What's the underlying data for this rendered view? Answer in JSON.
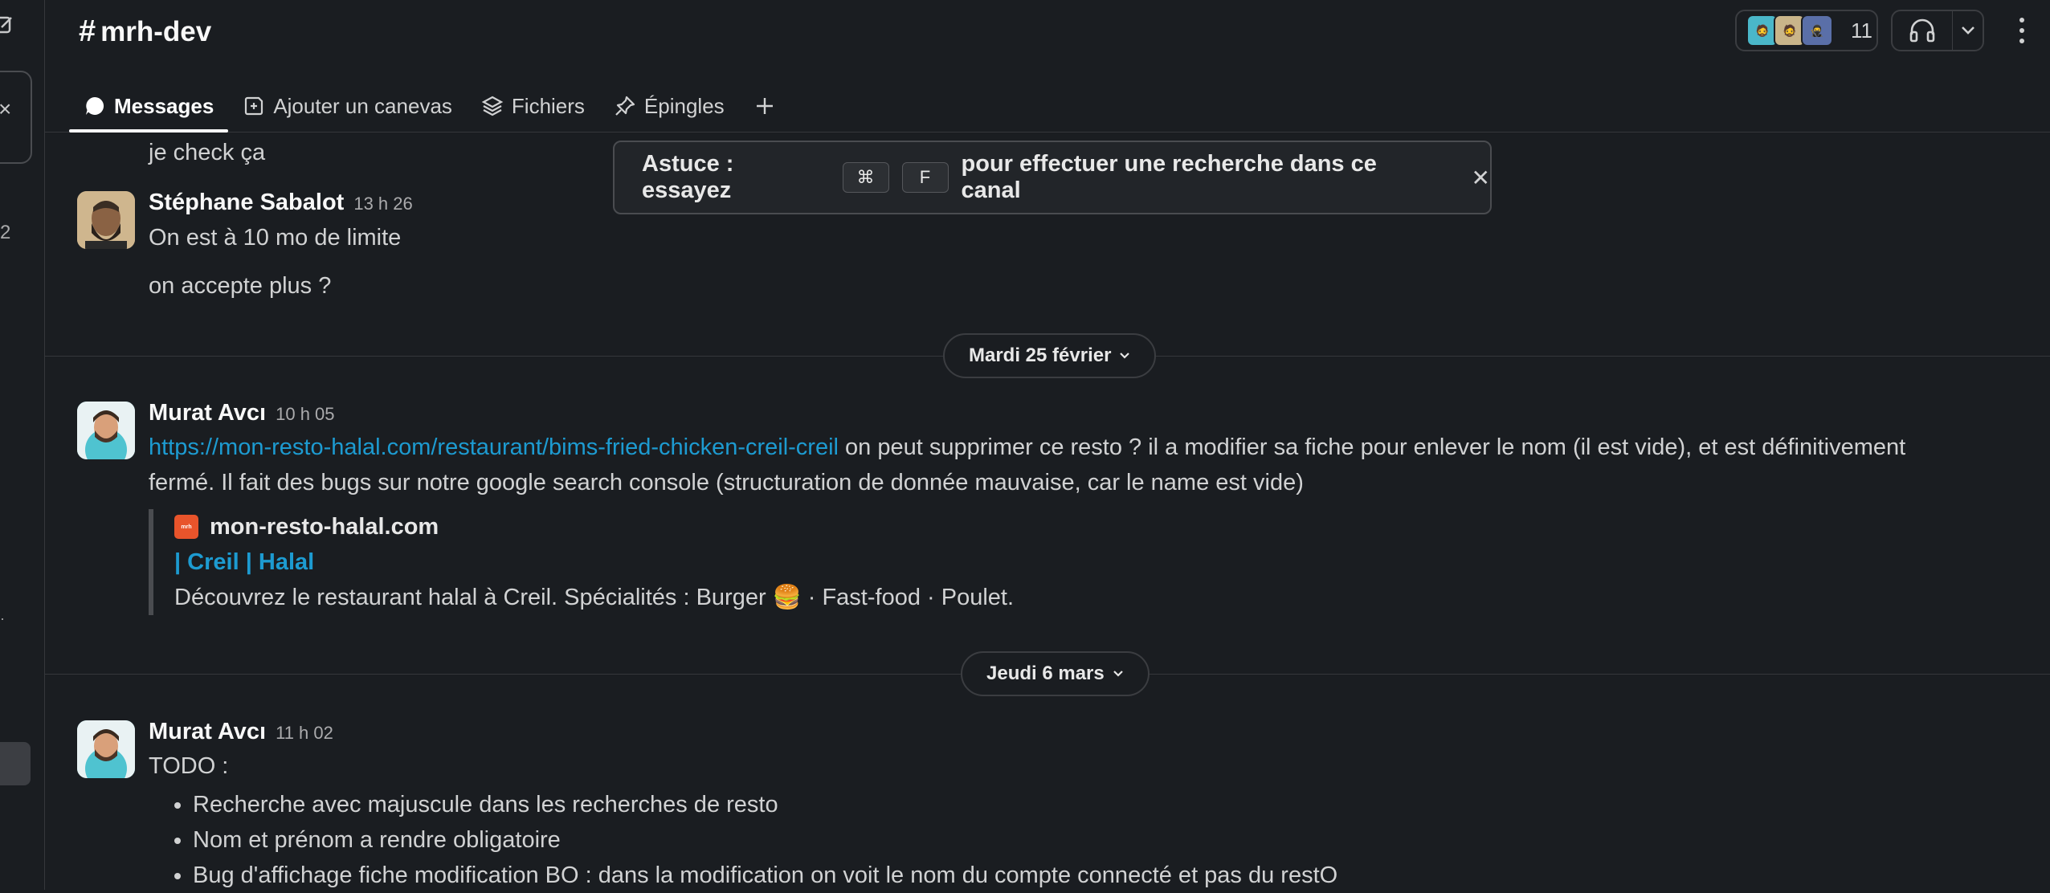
{
  "channel": {
    "name": "mrh-dev"
  },
  "header": {
    "member_count": "11",
    "tabs": [
      {
        "label": "Messages"
      },
      {
        "label": "Ajouter un canevas"
      },
      {
        "label": "Fichiers"
      },
      {
        "label": "Épingles"
      }
    ]
  },
  "rail": {
    "badge": "2"
  },
  "tip": {
    "prefix": "Astuce : essayez",
    "key1": "⌘",
    "key2": "F",
    "suffix": "pour effectuer une recherche dans ce canal"
  },
  "messages": {
    "m0_text": "je check ça",
    "m1": {
      "author": "Stéphane Sabalot",
      "time": "13 h 26",
      "line1": "On est à 10 mo de limite",
      "line2": "on accepte plus ?"
    },
    "day1": "Mardi 25 février",
    "m2": {
      "author": "Murat Avcı",
      "time": "10 h 05",
      "link": "https://mon-resto-halal.com/restaurant/bims-fried-chicken-creil-creil",
      "text_after_link": " on peut supprimer ce resto ? il a modifier sa fiche pour enlever le nom (il est vide), et est définitivement",
      "line2": "fermé. Il fait des bugs sur notre google search console (structuration de donnée mauvaise, car le name est vide)",
      "unfurl": {
        "site": "mon-resto-halal.com",
        "title": "| Creil | Halal",
        "desc_before": "Découvrez le restaurant halal à Creil. Spécialités : Burger",
        "emoji": "🍔",
        "desc_after": "· Fast-food · Poulet."
      }
    },
    "day2": "Jeudi 6 mars",
    "m3": {
      "author": "Murat Avcı",
      "time": "11 h 02",
      "heading": "TODO :",
      "items": [
        "Recherche avec majuscule dans les recherches de resto",
        "Nom et prénom a rendre obligatoire",
        "Bug d'affichage fiche modification BO : dans la modification on voit le nom du compte connecté et pas du restO"
      ]
    }
  },
  "colors": {
    "background": "#1a1d21",
    "link": "#1d9bd1",
    "border": "#35373b"
  },
  "icons": [
    "compose-icon",
    "close-icon",
    "chat-bubble-icon",
    "canvas-icon",
    "layers-icon",
    "pin-icon",
    "plus-icon",
    "headphones-icon",
    "chevron-down-icon",
    "kebab-icon"
  ]
}
